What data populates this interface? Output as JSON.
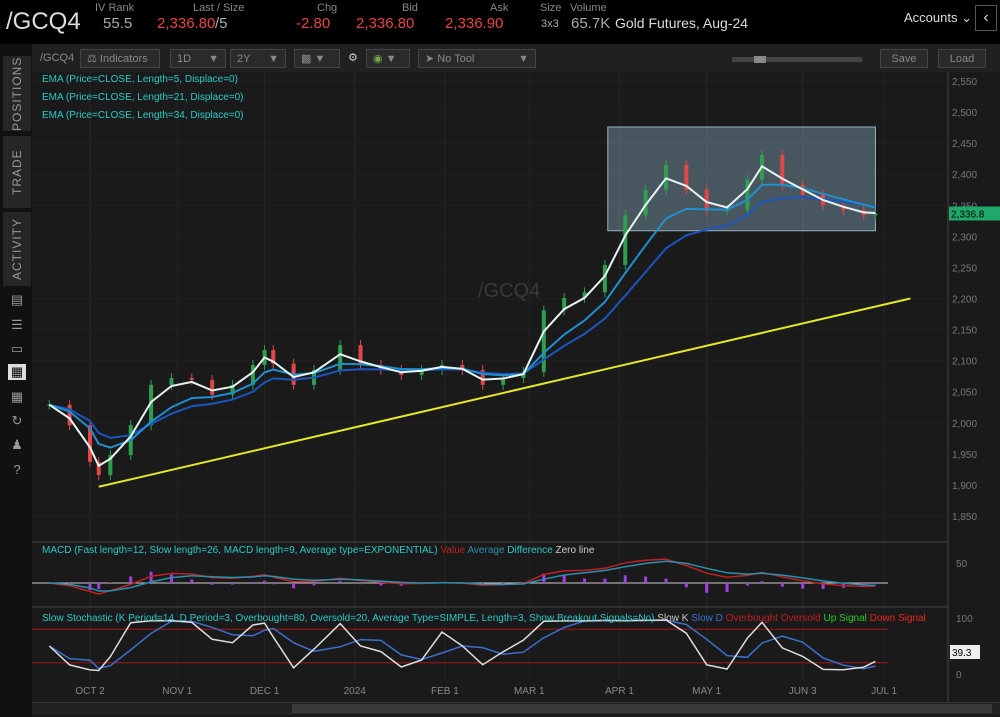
{
  "header": {
    "symbol": "/GCQ4",
    "iv_rank_label": "IV Rank",
    "iv_rank": "55.5",
    "last_label": "Last / Size",
    "last": "2,336.80",
    "last_size": "/5",
    "chg_label": "Chg",
    "chg": "-2.80",
    "bid_label": "Bid",
    "bid": "2,336.80",
    "ask_label": "Ask",
    "ask": "2,336.90",
    "size_label": "Size",
    "size": "3x3",
    "volume_label": "Volume",
    "volume": "65.7K",
    "description": "Gold Futures, Aug-24",
    "accounts": "Accounts"
  },
  "sidebar": {
    "tabs": [
      "POSITIONS",
      "TRADE",
      "ACTIVITY"
    ],
    "icons": [
      "calendar-icon",
      "list-icon",
      "monitor-icon",
      "chart-icon",
      "grid-icon",
      "history-icon",
      "people-icon",
      "help-icon"
    ]
  },
  "toolbar": {
    "symbol": "/GCQ4",
    "indicators": "Indicators",
    "aggregation": "1D",
    "range": "2Y",
    "drawing_tool": "No Tool",
    "save": "Save",
    "load": "Load"
  },
  "studies": {
    "ema1": "EMA (Price=CLOSE, Length=5, Displace=0)",
    "ema2": "EMA (Price=CLOSE, Length=21, Displace=0)",
    "ema3": "EMA (Price=CLOSE, Length=34, Displace=0)",
    "macd": "MACD (Fast length=12, Slow length=26, MACD length=9, Average type=EXPONENTIAL)",
    "macd_value": "Value",
    "macd_avg": "Average",
    "macd_diff": "Difference",
    "macd_zero": "Zero line",
    "stoch": "Slow Stochastic (K Period=14, D Period=3, Overbought=80, Oversold=20, Average Type=SIMPLE, Length=3, Show Breakout Signals=No)",
    "slow_k": "Slow K",
    "slow_d": "Slow D",
    "overbought": "Overbought",
    "oversold": "Oversold",
    "up_signal": "Up Signal",
    "down_signal": "Down Signal"
  },
  "watermark": "/GCQ4",
  "colors": {
    "up": "#2e9e4f",
    "down": "#e04848",
    "ema5": "#e8f4f4",
    "ema21": "#1e8fd0",
    "ema34": "#1a55c0",
    "trendline": "#e6e62a",
    "box": "#8fb4c8",
    "macd_value": "#c02020",
    "macd_avg": "#2a8fb0",
    "stoch_k": "#dddddd",
    "stoch_d": "#3b6fd0"
  },
  "chart_data": {
    "type": "candlestick",
    "ylim": [
      1825,
      2575
    ],
    "y_ticks": [
      "2,550",
      "2,500",
      "2,450",
      "2,400",
      "2,350",
      "2,300",
      "2,250",
      "2,200",
      "2,150",
      "2,100",
      "2,050",
      "2,000",
      "1,950",
      "1,900",
      "1,850"
    ],
    "x_ticks": [
      {
        "label": "OCT 2",
        "date": "2023-10-02"
      },
      {
        "label": "NOV 1",
        "date": "2023-11-01"
      },
      {
        "label": "DEC 1",
        "date": "2023-12-01"
      },
      {
        "label": "2024",
        "date": "2024-01-01"
      },
      {
        "label": "FEB 1",
        "date": "2024-02-01"
      },
      {
        "label": "MAR 1",
        "date": "2024-03-01"
      },
      {
        "label": "APR 1",
        "date": "2024-04-01"
      },
      {
        "label": "MAY 1",
        "date": "2024-05-01"
      },
      {
        "label": "JUN 3",
        "date": "2024-06-03"
      },
      {
        "label": "JUL 1",
        "date": "2024-07-01"
      }
    ],
    "dates": [
      "2023-09-18",
      "2023-09-25",
      "2023-10-02",
      "2023-10-05",
      "2023-10-09",
      "2023-10-16",
      "2023-10-23",
      "2023-10-30",
      "2023-11-06",
      "2023-11-13",
      "2023-11-20",
      "2023-11-27",
      "2023-12-01",
      "2023-12-04",
      "2023-12-11",
      "2023-12-18",
      "2023-12-27",
      "2024-01-03",
      "2024-01-10",
      "2024-01-17",
      "2024-01-24",
      "2024-01-31",
      "2024-02-07",
      "2024-02-14",
      "2024-02-21",
      "2024-02-28",
      "2024-03-06",
      "2024-03-13",
      "2024-03-20",
      "2024-03-27",
      "2024-04-03",
      "2024-04-10",
      "2024-04-17",
      "2024-04-24",
      "2024-05-01",
      "2024-05-08",
      "2024-05-15",
      "2024-05-20",
      "2024-05-27",
      "2024-06-03",
      "2024-06-10",
      "2024-06-17",
      "2024-06-24",
      "2024-06-28"
    ],
    "close": [
      2029,
      1996,
      1937,
      1916,
      1948,
      1996,
      2061,
      2072,
      2069,
      2045,
      2061,
      2093,
      2117,
      2095,
      2061,
      2085,
      2125,
      2093,
      2085,
      2077,
      2085,
      2093,
      2085,
      2061,
      2072,
      2082,
      2181,
      2201,
      2210,
      2254,
      2334,
      2375,
      2415,
      2375,
      2342,
      2342,
      2391,
      2431,
      2383,
      2367,
      2350,
      2342,
      2334,
      2337
    ],
    "last_price": "2,336.8",
    "macd_ticks": [
      "50"
    ],
    "stoch_ticks": [
      "100",
      "0"
    ],
    "stoch_last": "39.3",
    "trendline": {
      "start": {
        "date": "2023-10-05",
        "price": 1897
      },
      "end": {
        "date": "2024-07-10",
        "price": 2200
      }
    },
    "range_box": {
      "start": "2024-03-28",
      "end": "2024-06-28",
      "high": 2476,
      "low": 2309
    }
  }
}
